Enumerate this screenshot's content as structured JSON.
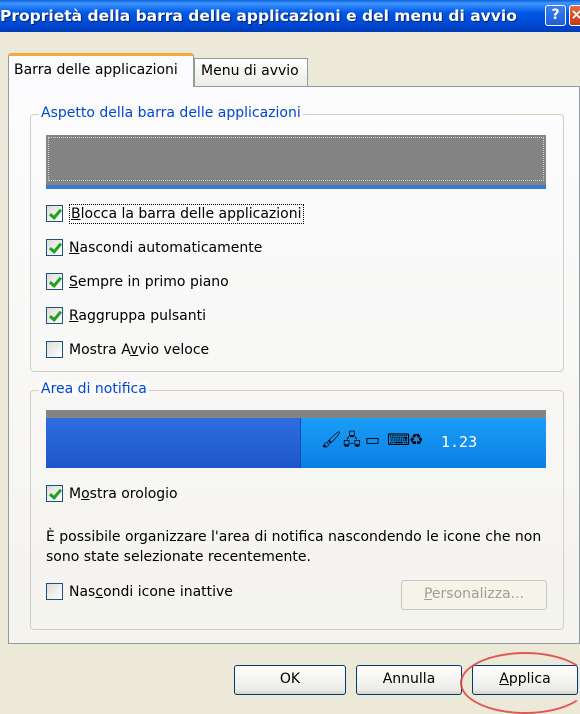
{
  "window": {
    "title": "Proprietà della barra delle applicazioni e del menu di avvio",
    "help_icon": "help-icon",
    "close_icon": "close-icon"
  },
  "tabs": [
    {
      "label": "Barra delle applicazioni",
      "selected": true
    },
    {
      "label": "Menu di avvio",
      "selected": false
    }
  ],
  "appearance_group": {
    "legend": "Aspetto della barra delle applicazioni",
    "options": [
      {
        "pre": "",
        "key": "B",
        "post": "locca la barra delle applicazioni",
        "checked": true
      },
      {
        "pre": "",
        "key": "N",
        "post": "ascondi automaticamente",
        "checked": true
      },
      {
        "pre": "",
        "key": "S",
        "post": "empre in primo piano",
        "checked": true
      },
      {
        "pre": "",
        "key": "R",
        "post": "aggruppa pulsanti",
        "checked": true
      },
      {
        "pre": "Mostra A",
        "key": "v",
        "post": "vio veloce",
        "checked": false
      }
    ]
  },
  "notify_group": {
    "legend": "Area di notifica",
    "tray_icons": [
      "paint-icon",
      "network-icon",
      "monitor-icon",
      "keyboard-icon",
      "software-icon"
    ],
    "clock": "1.23",
    "show_clock": {
      "pre": "M",
      "key": "o",
      "post": "stra orologio",
      "checked": true
    },
    "info": "È possibile organizzare l'area di notifica nascondendo le icone che non sono state selezionate recentemente.",
    "hide_inactive": {
      "pre": "Nas",
      "key": "c",
      "post": "ondi icone inattive",
      "checked": false
    },
    "customize_button": {
      "key": "P",
      "post": "ersonalizza...",
      "enabled": false
    }
  },
  "buttons": {
    "ok": "OK",
    "cancel": "Annulla",
    "apply_key": "A",
    "apply_post": "pplica"
  },
  "colors": {
    "title_bar": "#0054e3",
    "legend_text": "#0046d5",
    "active_tab_accent": "#f3a93b",
    "checkmark": "#21a121",
    "highlight_circle": "#e04040"
  }
}
